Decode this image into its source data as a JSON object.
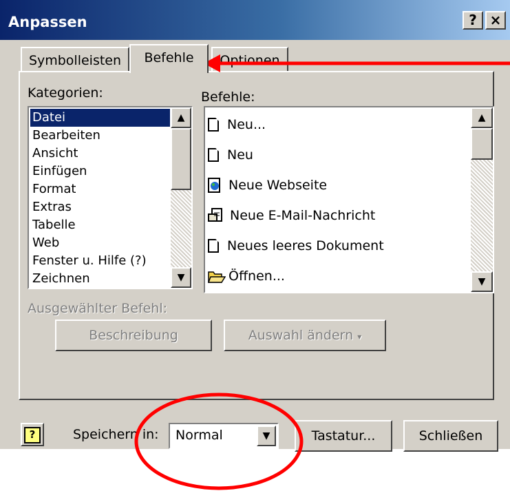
{
  "window": {
    "title": "Anpassen",
    "help_btn": "?",
    "close_btn": "×"
  },
  "tabs": {
    "toolbars": "Symbolleisten",
    "commands": "Befehle",
    "options": "Optionen"
  },
  "categories": {
    "label": "Kategorien:",
    "items": [
      "Datei",
      "Bearbeiten",
      "Ansicht",
      "Einfügen",
      "Format",
      "Extras",
      "Tabelle",
      "Web",
      "Fenster u. Hilfe (?)",
      "Zeichnen"
    ],
    "selected": "Datei"
  },
  "commands": {
    "label": "Befehle:",
    "items": [
      {
        "label": "Neu...",
        "icon": "new-document-icon"
      },
      {
        "label": "Neu",
        "icon": "new-document-icon"
      },
      {
        "label": "Neue Webseite",
        "icon": "web-page-icon"
      },
      {
        "label": "Neue E-Mail-Nachricht",
        "icon": "email-message-icon"
      },
      {
        "label": "Neues leeres Dokument",
        "icon": "blank-document-icon"
      },
      {
        "label": "Öffnen...",
        "icon": "open-folder-icon"
      }
    ]
  },
  "selected_command": {
    "label": "Ausgewählter Befehl:",
    "description_btn": "Beschreibung",
    "modify_btn": "Auswahl ändern"
  },
  "footer": {
    "save_in_label": "Speichern in:",
    "save_in_value": "Normal",
    "keyboard_btn": "Tastatur...",
    "close_btn": "Schließen"
  },
  "annotation": {
    "arrow_color": "#ff0000",
    "ellipse_color": "#ff0000"
  }
}
